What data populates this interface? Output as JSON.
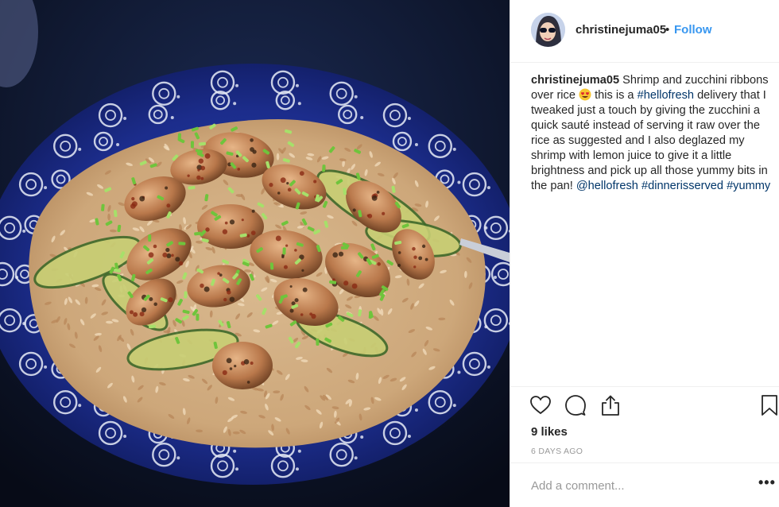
{
  "post": {
    "username": "christinejuma05",
    "follow_label": "Follow",
    "dot": "•",
    "caption": {
      "username": "christinejuma05",
      "text_1": " Shrimp and zucchini ribbons over rice ",
      "emoji": "heart-eyes-emoji",
      "text_2": " this is a ",
      "tag_1": "#hellofresh",
      "text_3": " delivery that I tweaked just a touch by giving the zucchini a quick sauté instead of serving it raw over the rice as suggested and I also deglazed my shrimp with lemon juice to give it a little brightness and pick up all those yummy bits in the pan! ",
      "tag_2": "@hellofresh",
      "text_4": " ",
      "tag_3": "#dinnerisserved",
      "text_5": " ",
      "tag_4": "#yummy"
    },
    "likes_label": "9 likes",
    "time_label": "6 DAYS AGO",
    "comment_placeholder": "Add a comment...",
    "more_label": "•••"
  },
  "icons": {
    "like": "heart-icon",
    "comment": "comment-bubble-icon",
    "share": "share-icon",
    "save": "bookmark-icon"
  },
  "colors": {
    "link": "#003569",
    "follow": "#3897f0",
    "text": "#262626",
    "muted": "#999999",
    "plate_blue": "#1d2f8f"
  }
}
